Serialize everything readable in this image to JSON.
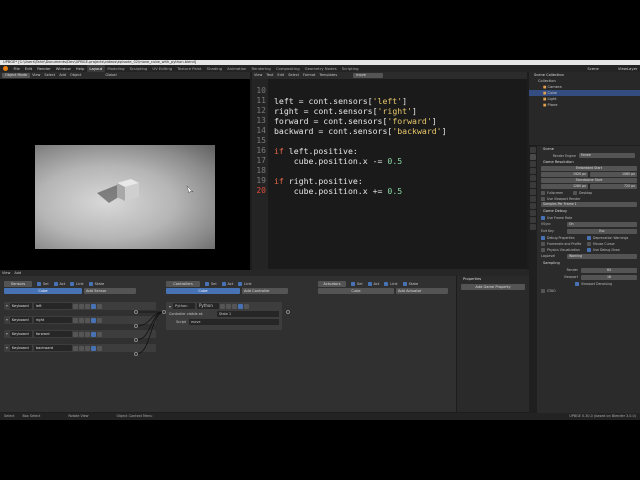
{
  "titlebar": {
    "text": "UPBGE* [C:\\Users\\Tahir\\Documents\\Dev\\UPBGE-projects\\videos\\episode_02\\move_cube_with_python.blend]"
  },
  "menu": [
    "File",
    "Edit",
    "Render",
    "Window",
    "Help"
  ],
  "workspaces": [
    "Layout",
    "Modeling",
    "Sculpting",
    "UV Editing",
    "Texture Paint",
    "Shading",
    "Animation",
    "Rendering",
    "Compositing",
    "Geometry Nodes",
    "Scripting"
  ],
  "active_workspace": "Layout",
  "scene": {
    "label": "Scene",
    "view_layer": "ViewLayer"
  },
  "viewport_header": {
    "mode": "Object Mode",
    "items": [
      "View",
      "Select",
      "Add",
      "Object"
    ],
    "orientation": "Global"
  },
  "editor_header": {
    "items": [
      "View",
      "Text",
      "Edit",
      "Select",
      "Format",
      "Templates"
    ],
    "file": "move"
  },
  "code": {
    "lines": [
      {
        "n": "10",
        "text": ""
      },
      {
        "n": "11",
        "var": "left",
        "key": "'left'"
      },
      {
        "n": "12",
        "var": "right",
        "key": "'right'"
      },
      {
        "n": "13",
        "var": "forward",
        "key": "'forward'"
      },
      {
        "n": "14",
        "var": "backward",
        "key": "'backward'"
      },
      {
        "n": "15",
        "text": ""
      },
      {
        "n": "16",
        "cond": "left"
      },
      {
        "n": "17",
        "op": "-=",
        "val": "0.5"
      },
      {
        "n": "18",
        "text": ""
      },
      {
        "n": "19",
        "cond": "right"
      },
      {
        "n": "20",
        "op": "+=",
        "val": "0.5"
      }
    ],
    "assign_mid": " = cont.sensors[",
    "assign_end": "]",
    "if_kw": "if",
    "positive": ".positive:",
    "stmt": "cube.position.x "
  },
  "filepath": "File: *C:\\Users\\Tahir\\Documents\\Dev\\UPBGE-projects\\videos\\episode_02\\move.py (unsaved)",
  "outliner": {
    "title": "Scene Collection",
    "items": [
      "Collection",
      "Camera",
      "Cube",
      "Light",
      "Plane"
    ],
    "selected": "Cube"
  },
  "properties": {
    "object": "Scene",
    "render_engine_label": "Render Engine",
    "render_engine": "Eevee",
    "sections": {
      "game_resolution": "Game Resolution",
      "embedded": "Embedded Start",
      "standalone": "Standalone Start",
      "fullscreen": "Fullscreen",
      "desktop": "Desktop",
      "use_viewport": "Use Viewport Render",
      "samples": "Samples Per Frame",
      "samples_val": "1",
      "game_debug": "Game Debug",
      "use_framerate": "Use Frame Rate",
      "vsync": "VSync",
      "vsync_val": "On",
      "exit_key": "Exit Key",
      "exit_val": "Esc",
      "debug_props": "Debug Properties",
      "depr": "Deprecation Warnings",
      "framerate_profile": "Framerate and Profile",
      "mouse_cursor": "Mouse Cursor",
      "physics_vis": "Physics Visualization",
      "use_dbg": "Use Debug Draw",
      "log_level": "LogLevel",
      "log_val": "Warning",
      "sampling": "Sampling",
      "render": "Render",
      "render_val": "64",
      "viewport": "Viewport",
      "viewport_val": "16",
      "denoise": "Viewport Denoising",
      "gtao": "GTAO"
    },
    "res_x": "1920 px",
    "res_y": "1080 px",
    "res_x2": "1280 px",
    "res_y2": "720 px"
  },
  "logic": {
    "header_items": [
      "View",
      "Add"
    ],
    "sensors": {
      "label": "Sensors",
      "toggles": [
        "Sel",
        "Act",
        "Link",
        "State"
      ],
      "object": "Cube",
      "add": "Add Sensor"
    },
    "controllers": {
      "label": "Controllers",
      "toggles": [
        "Sel",
        "Act",
        "Link"
      ],
      "object": "Cube",
      "add": "Add Controller"
    },
    "actuators": {
      "label": "Actuators",
      "toggles": [
        "Sel",
        "Act",
        "Link",
        "State"
      ],
      "object": "Cube",
      "add": "Add Actuator"
    },
    "sensor_bricks": [
      {
        "type": "Keyboard",
        "name": "left"
      },
      {
        "type": "Keyboard",
        "name": "right"
      },
      {
        "type": "Keyboard",
        "name": "forward"
      },
      {
        "type": "Keyboard",
        "name": "backward"
      }
    ],
    "controller": {
      "type": "Python",
      "name": "Python",
      "visible_at": "Controller visible at:",
      "state": "State 1",
      "script_label": "Script",
      "script": "move"
    },
    "properties_panel": {
      "title": "Properties",
      "add": "Add Game Property"
    }
  },
  "status": {
    "select": "Select",
    "box": "Box Select",
    "rotate": "Rotate View",
    "context": "Object Context Menu",
    "version": "UPBGE 0.30.0 (based on Blender 3.0.0)"
  }
}
